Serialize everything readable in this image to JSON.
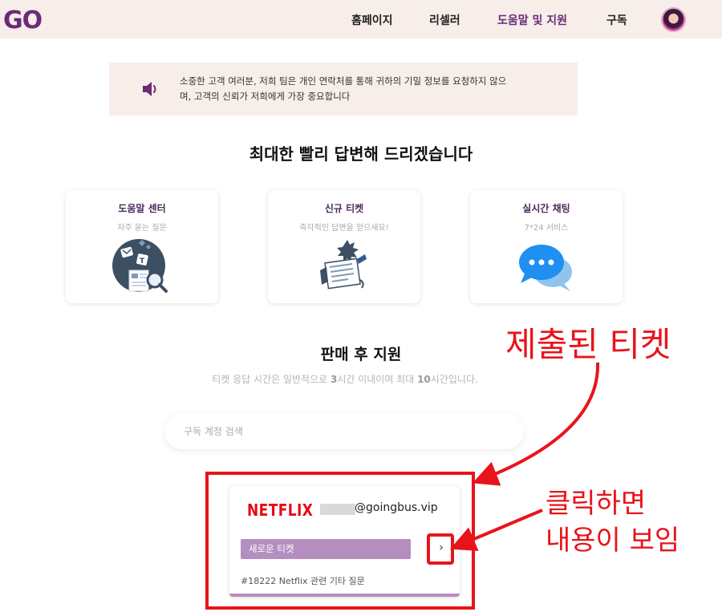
{
  "header": {
    "logo": "GO",
    "nav": [
      "홈페이지",
      "리셀러",
      "도움말 및 지원",
      "구독"
    ],
    "active_nav": "도움말 및 지원"
  },
  "notice": {
    "icon": "speaker-icon",
    "line1": "소중한 고객 여러분, 저희 팀은 개인 연락처를 통해 귀하의 기밀 정보를 요청하지 않으",
    "line2": "며, 고객의 신뢰가 저희에게 가장 중요합니다"
  },
  "main_title": "최대한 빨리 답변해 드리겠습니다",
  "cards": [
    {
      "title": "도움말 센터",
      "subtitle": "자주 묻는 질문",
      "icon": "faq-illustration"
    },
    {
      "title": "신규 티켓",
      "subtitle": "즉각적인 답변을 얻으세요!",
      "icon": "ticket-illustration"
    },
    {
      "title": "실시간 채팅",
      "subtitle": "7*24 서비스",
      "icon": "chat-bubble-icon"
    }
  ],
  "after_sales": {
    "title": "판매 후 지원",
    "note_prefix": "티켓 응답 시간은 일반적으로 ",
    "note_num1": "3",
    "note_mid": "시간 이내이며 최대 ",
    "note_num2": "10",
    "note_suffix": "시간입니다."
  },
  "search": {
    "placeholder": "구독 계정 검색"
  },
  "ticket": {
    "brand": "NETFLIX",
    "email": "@goingbus.vip",
    "status": "새로운 티켓",
    "chevron": "›",
    "id_text": "#18222 Netflix 관련 기타 질문"
  },
  "annotations": {
    "submitted": "제출된 티켓",
    "click_line1": "클릭하면",
    "click_line2": "내용이 보임"
  },
  "colors": {
    "accent": "#6a2b79",
    "status": "#b58ec0",
    "annotation": "#e8141b",
    "netflix": "#e50914"
  }
}
